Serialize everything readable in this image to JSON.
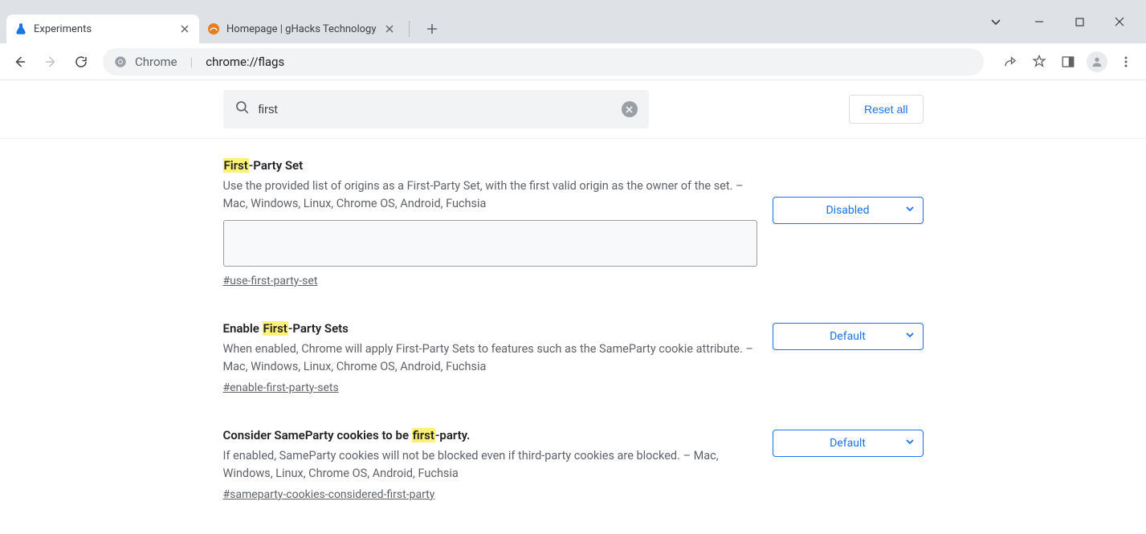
{
  "tabs": [
    {
      "title": "Experiments",
      "favicon": "flask"
    },
    {
      "title": "Homepage | gHacks Technology",
      "favicon": "ghacks"
    }
  ],
  "omnibox": {
    "prefix": "Chrome",
    "path": "chrome://flags"
  },
  "search": {
    "value": "first"
  },
  "reset_label": "Reset all",
  "flags": [
    {
      "title_pre": "",
      "title_hl": "First",
      "title_post": "-Party Set",
      "desc": "Use the provided list of origins as a First-Party Set, with the first valid origin as the owner of the set. – Mac, Windows, Linux, Chrome OS, Android, Fuchsia",
      "has_textarea": true,
      "anchor": "#use-first-party-set",
      "select": "Disabled"
    },
    {
      "title_pre": "Enable ",
      "title_hl": "First",
      "title_post": "-Party Sets",
      "desc": "When enabled, Chrome will apply First-Party Sets to features such as the SameParty cookie attribute. – Mac, Windows, Linux, Chrome OS, Android, Fuchsia",
      "has_textarea": false,
      "anchor": "#enable-first-party-sets",
      "select": "Default"
    },
    {
      "title_pre": "Consider SameParty cookies to be ",
      "title_hl": "first",
      "title_post": "-party.",
      "desc": "If enabled, SameParty cookies will not be blocked even if third-party cookies are blocked. – Mac, Windows, Linux, Chrome OS, Android, Fuchsia",
      "has_textarea": false,
      "anchor": "#sameparty-cookies-considered-first-party",
      "select": "Default"
    }
  ]
}
